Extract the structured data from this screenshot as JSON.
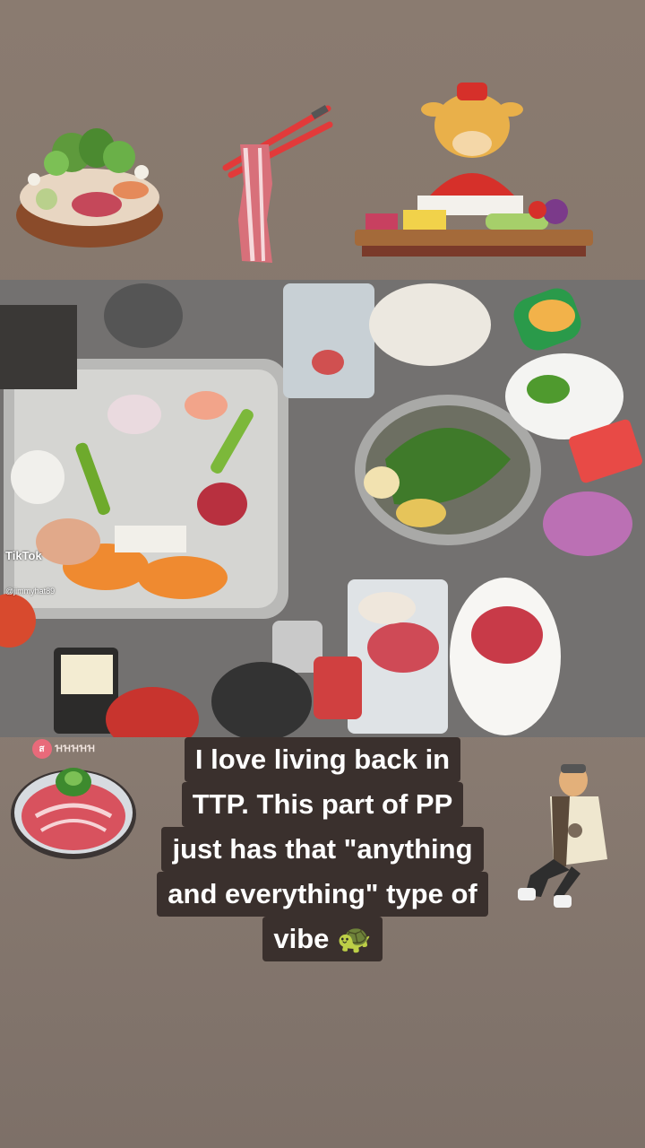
{
  "overlay": {
    "tiktok_label": "TikTok",
    "tiktok_user": "@jimmyhat89"
  },
  "brand": {
    "badge": "ส",
    "name": "ꞪꞪꞪꞪꞪ"
  },
  "caption": {
    "lines": [
      "I love living back in",
      "TTP. This part of PP",
      "just has that \"anything",
      "and everything\" type of",
      "vibe 🐢"
    ]
  },
  "colors": {
    "background": "#8a7b70",
    "caption_bg": "#3a302d",
    "caption_text": "#ffffff"
  }
}
